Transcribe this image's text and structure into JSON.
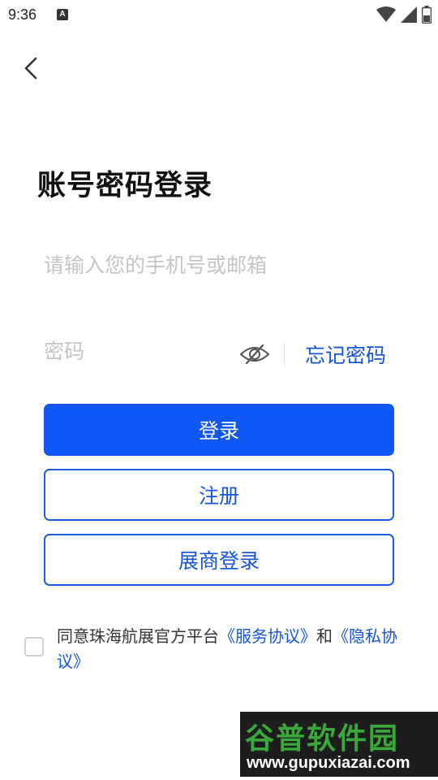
{
  "status_bar": {
    "time": "9:36",
    "indicator": "A",
    "icons": [
      "wifi-icon",
      "signal-icon",
      "battery-icon"
    ]
  },
  "header": {
    "back_icon": "back-arrow-icon"
  },
  "title": "账号密码登录",
  "phone": {
    "value": "",
    "placeholder": "请输入您的手机号或邮箱"
  },
  "password": {
    "value": "",
    "placeholder": "密码",
    "visibility_icon": "eye-hidden-icon",
    "forgot_label": "忘记密码"
  },
  "buttons": {
    "login": "登录",
    "register": "注册",
    "exhibitor_login": "展商登录"
  },
  "agreement": {
    "checked": false,
    "prefix": "同意珠海航展官方平台",
    "service_link": "《服务协议》",
    "and": "和",
    "privacy_link": "《隐私协议》"
  },
  "watermark": {
    "brand": "谷普软件园",
    "url": "www.gupuxiazai.com"
  },
  "colors": {
    "primary": "#1058f5",
    "link": "#1455d9",
    "placeholder": "#c4c4c4",
    "title": "#111111"
  }
}
